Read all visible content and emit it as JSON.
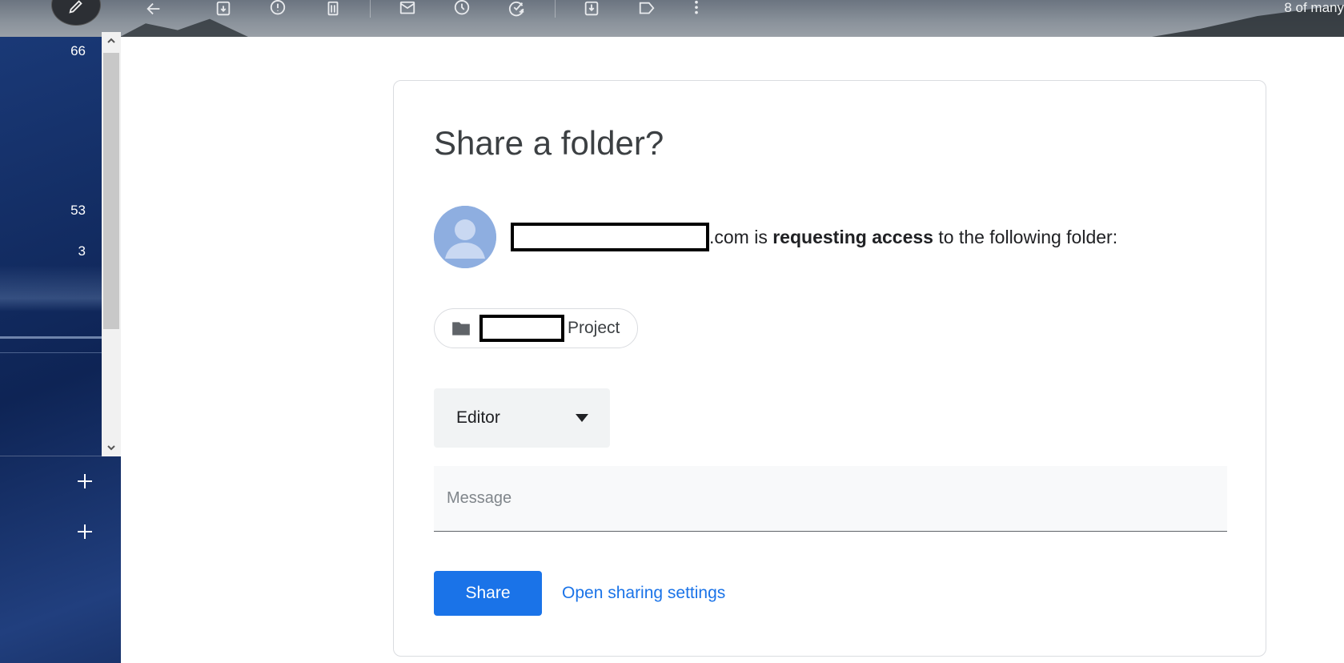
{
  "toolbar": {
    "pager_text": "8 of many",
    "icons": [
      "back-arrow-icon",
      "archive-icon",
      "report-spam-icon",
      "delete-icon",
      "mark-unread-icon",
      "snooze-icon",
      "add-task-icon",
      "move-to-icon",
      "label-icon",
      "more-vert-icon"
    ]
  },
  "leftnav": {
    "counts": [
      "66",
      "53",
      "3"
    ]
  },
  "card": {
    "title": "Share a folder?",
    "request_suffix": ".com is ",
    "request_bold": "requesting access",
    "request_tail": " to the following folder:",
    "folder_name_suffix": "Project",
    "role_selected": "Editor",
    "message_placeholder": "Message",
    "share_label": "Share",
    "settings_link": "Open sharing settings"
  },
  "colors": {
    "primary": "#1a73e8",
    "title": "#3c4043",
    "avatar": "#8eaee0"
  }
}
